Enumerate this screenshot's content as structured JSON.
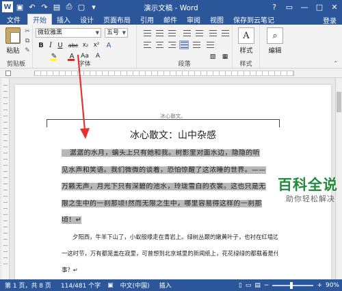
{
  "window": {
    "title": "演示文稿 - Word",
    "controls": [
      "?",
      "▭",
      "—",
      "□",
      "✕"
    ]
  },
  "qat": {
    "icons": [
      "word-logo-icon",
      "save-icon",
      "undo-icon",
      "redo-icon",
      "save-icon",
      "print-icon",
      "print-preview-icon",
      "customize-icon"
    ]
  },
  "tabs": [
    {
      "label": "文件"
    },
    {
      "label": "开始"
    },
    {
      "label": "插入"
    },
    {
      "label": "设计"
    },
    {
      "label": "页面布局"
    },
    {
      "label": "引用"
    },
    {
      "label": "邮件"
    },
    {
      "label": "审阅"
    },
    {
      "label": "视图"
    },
    {
      "label": "保存到云笔记"
    }
  ],
  "active_tab": "开始",
  "login_label": "登录",
  "ribbon": {
    "clipboard": {
      "paste_label": "粘贴",
      "group_label": "剪贴板"
    },
    "font": {
      "font_name": "微软雅黑",
      "font_size": "五号",
      "group_label": "字体",
      "buttons": [
        "B",
        "I",
        "U",
        "abc",
        "x₂",
        "x²",
        "A",
        "A",
        "Aa",
        "A"
      ],
      "highlight_color": "#ffff00",
      "font_color": "#e02020"
    },
    "paragraph": {
      "group_label": "段落"
    },
    "styles": {
      "label": "样式",
      "group_label": "样式"
    },
    "editing": {
      "label": "编辑"
    }
  },
  "document": {
    "header_text": "冰心散文。",
    "title": "冰心散文：山中杂感",
    "para1_lines": [
      "潺潺的水月，螭头上只有她和我。树影里对面水边，隐隐的听",
      "见水声和笑语。我们微微的谈着，恐怕惊醒了这浓睡的世界。——",
      "万籁无声，月光下只有深碧的池水，玲珑雪白的衣裳。这也只是无",
      "限之生中的一刹那顷!然而无限之生中，哪里容易得这样的一刹那",
      "顷！↵"
    ],
    "para2_lines": [
      "夕阳西，牛羊下山了，小蚁般缘走在青岩上。绿树丛巅的嫩黄叶子，也衬在红墙边。——",
      "一这时节，万有都笼盖在寂里，可曾想到北京城里的新闻纸上，花花绿绿的都载着是什么",
      "事？↵"
    ]
  },
  "statusbar": {
    "page": "第 1 页，共 8 页",
    "words": "114/481 个字",
    "language": "中文(中国)",
    "mode": "插入",
    "zoom": "90%"
  },
  "watermark": {
    "main": "百科全说",
    "sub": "助你轻松解决"
  },
  "annotation": {
    "color": "#e53030"
  }
}
